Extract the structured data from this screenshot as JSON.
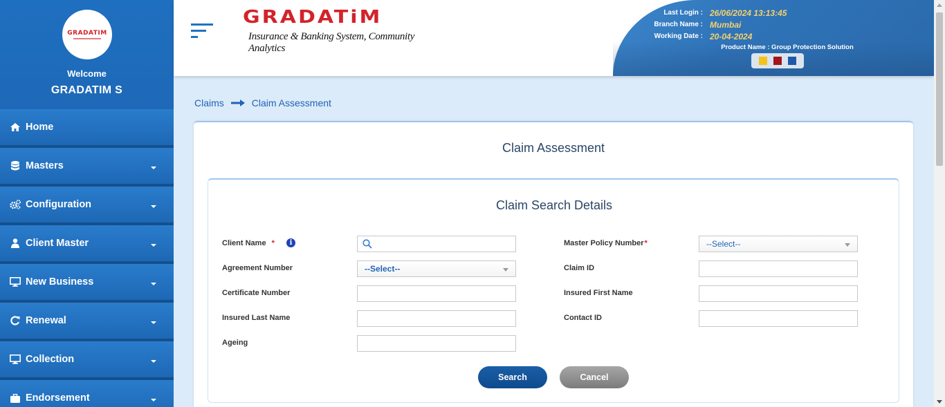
{
  "sidebar": {
    "logo_text": "GRADATIM",
    "welcome": "Welcome",
    "username": "GRADATIM S",
    "items": [
      {
        "label": "Home",
        "icon": "home-icon",
        "has_caret": false
      },
      {
        "label": "Masters",
        "icon": "database-icon",
        "has_caret": true
      },
      {
        "label": "Configuration",
        "icon": "cogs-icon",
        "has_caret": true
      },
      {
        "label": "Client Master",
        "icon": "user-icon",
        "has_caret": true
      },
      {
        "label": "New Business",
        "icon": "desktop-icon",
        "has_caret": true
      },
      {
        "label": "Renewal",
        "icon": "refresh-icon",
        "has_caret": true
      },
      {
        "label": "Collection",
        "icon": "desktop-icon",
        "has_caret": true
      },
      {
        "label": "Endorsement",
        "icon": "briefcase-icon",
        "has_caret": true
      }
    ]
  },
  "header": {
    "logo_main": "GRADATiM",
    "logo_tagline": "Insurance & Banking System, Community Analytics",
    "last_login_label": "Last Login :",
    "last_login_value": "26/06/2024 13:13:45",
    "branch_label": "Branch Name :",
    "branch_value": "Mumbai",
    "working_date_label": "Working Date :",
    "working_date_value": "20-04-2024",
    "product_name": "Product Name : Group Protection Solution",
    "theme_colors": [
      "#f4c21b",
      "#a3151b",
      "#1e5aa8"
    ]
  },
  "breadcrumb": {
    "items": [
      "Claims",
      "Claim Assessment"
    ]
  },
  "card": {
    "title": "Claim Assessment",
    "section_title": "Claim Search Details"
  },
  "form": {
    "client_name_label": "Client Name",
    "client_name_value": "",
    "master_policy_label": "Master Policy Number",
    "master_policy_value": "--Select--",
    "agreement_label": "Agreement Number",
    "agreement_value": "--Select--",
    "claim_id_label": "Claim ID",
    "claim_id_value": "",
    "certificate_label": "Certificate Number",
    "certificate_value": "",
    "insured_first_label": "Insured First Name",
    "insured_first_value": "",
    "insured_last_label": "Insured Last Name",
    "insured_last_value": "",
    "contact_id_label": "Contact ID",
    "contact_id_value": "",
    "ageing_label": "Ageing",
    "ageing_value": "",
    "required_mark": "*"
  },
  "buttons": {
    "search": "Search",
    "cancel": "Cancel"
  },
  "colors": {
    "sidebar": "#1d68b5",
    "brand_red": "#d2232a",
    "link_blue": "#1e63b8",
    "search_btn": "#1b5fa8",
    "cancel_btn": "#8d8d8d"
  }
}
